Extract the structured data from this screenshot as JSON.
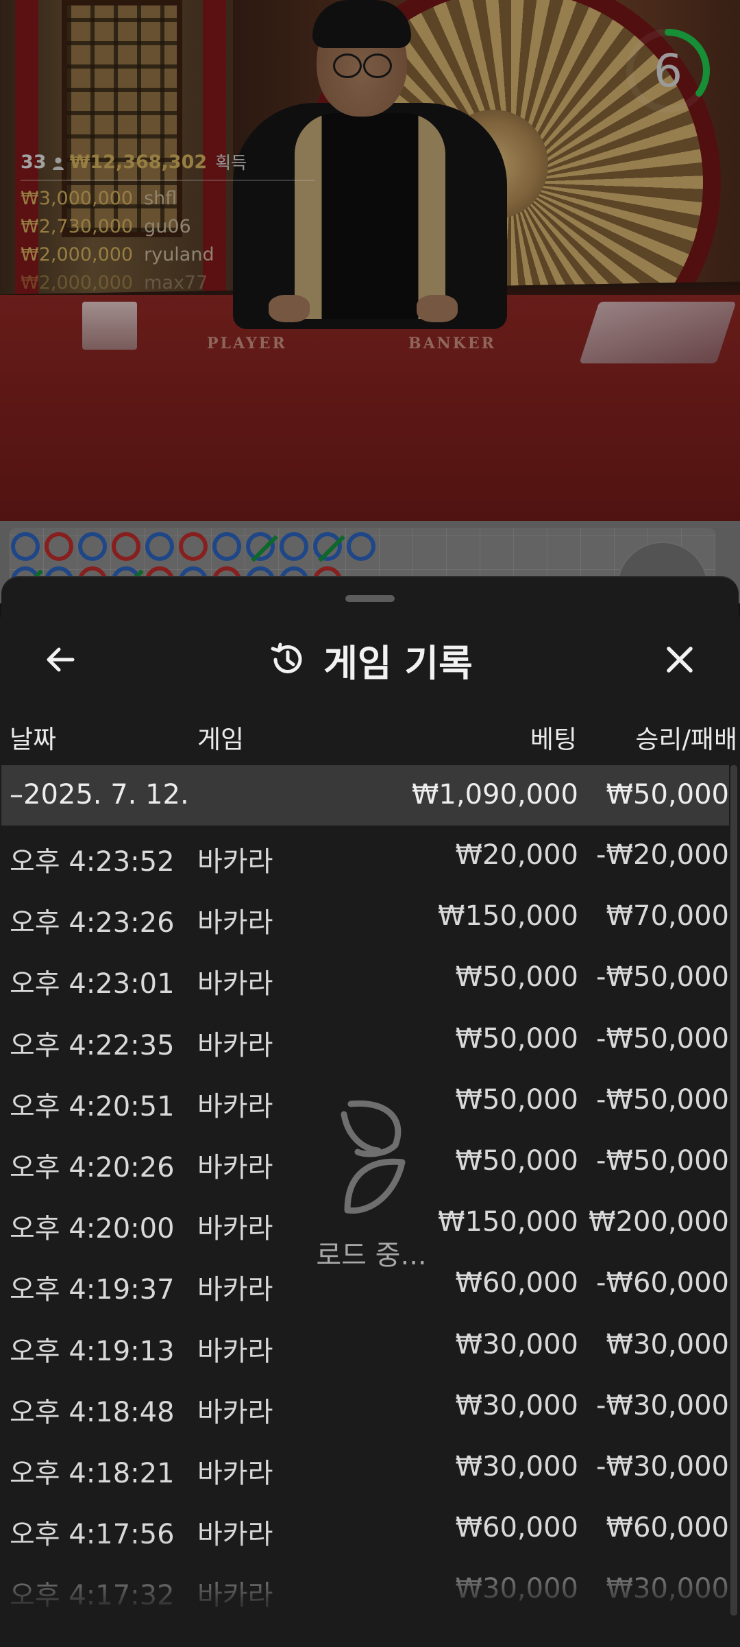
{
  "video": {
    "table_labels": {
      "player": "PLAYER",
      "banker": "BANKER"
    },
    "stats": {
      "players": "33",
      "total_winnings": "₩12,368,302",
      "gain_label": "획득",
      "winners": [
        {
          "amount": "₩3,000,000",
          "name": "shfl"
        },
        {
          "amount": "₩2,730,000",
          "name": "gu06"
        },
        {
          "amount": "₩2,000,000",
          "name": "ryuland"
        },
        {
          "amount": "₩2,000,000",
          "name": "max77"
        }
      ]
    },
    "timer": {
      "seconds": "6",
      "progress": 0.35,
      "color": "#1fbf4a"
    }
  },
  "roadmap": {
    "row1": [
      "P",
      "B",
      "P",
      "B",
      "P",
      "B",
      "P",
      "T",
      "P",
      "T",
      "P"
    ],
    "colors": {
      "player": "#2a5fb5",
      "banker": "#b52a2a",
      "tie": "#138a3a"
    }
  },
  "sheet": {
    "title": "게임 기록",
    "icons": {
      "back": "arrow-left-icon",
      "history": "history-icon",
      "close": "close-icon"
    },
    "columns": {
      "date": "날짜",
      "game": "게임",
      "bet": "베팅",
      "result": "승리/패배"
    },
    "summary": {
      "date": "–2025. 7. 12.",
      "bet": "₩1,090,000",
      "result": "₩50,000"
    },
    "rows": [
      {
        "time": "오후 4:23:52",
        "game": "바카라",
        "bet": "₩20,000",
        "result": "-₩20,000"
      },
      {
        "time": "오후 4:23:26",
        "game": "바카라",
        "bet": "₩150,000",
        "result": "₩70,000"
      },
      {
        "time": "오후 4:23:01",
        "game": "바카라",
        "bet": "₩50,000",
        "result": "-₩50,000"
      },
      {
        "time": "오후 4:22:35",
        "game": "바카라",
        "bet": "₩50,000",
        "result": "-₩50,000"
      },
      {
        "time": "오후 4:20:51",
        "game": "바카라",
        "bet": "₩50,000",
        "result": "-₩50,000"
      },
      {
        "time": "오후 4:20:26",
        "game": "바카라",
        "bet": "₩50,000",
        "result": "-₩50,000"
      },
      {
        "time": "오후 4:20:00",
        "game": "바카라",
        "bet": "₩150,000",
        "result": "₩200,000"
      },
      {
        "time": "오후 4:19:37",
        "game": "바카라",
        "bet": "₩60,000",
        "result": "-₩60,000"
      },
      {
        "time": "오후 4:19:13",
        "game": "바카라",
        "bet": "₩30,000",
        "result": "₩30,000"
      },
      {
        "time": "오후 4:18:48",
        "game": "바카라",
        "bet": "₩30,000",
        "result": "-₩30,000"
      },
      {
        "time": "오후 4:18:21",
        "game": "바카라",
        "bet": "₩30,000",
        "result": "-₩30,000"
      },
      {
        "time": "오후 4:17:56",
        "game": "바카라",
        "bet": "₩60,000",
        "result": "₩60,000"
      },
      {
        "time": "오후 4:17:32",
        "game": "바카라",
        "bet": "₩30,000",
        "result": "₩30,000"
      }
    ],
    "loading": {
      "text": "로드 중...",
      "icon": "loading-spinner-icon"
    }
  }
}
